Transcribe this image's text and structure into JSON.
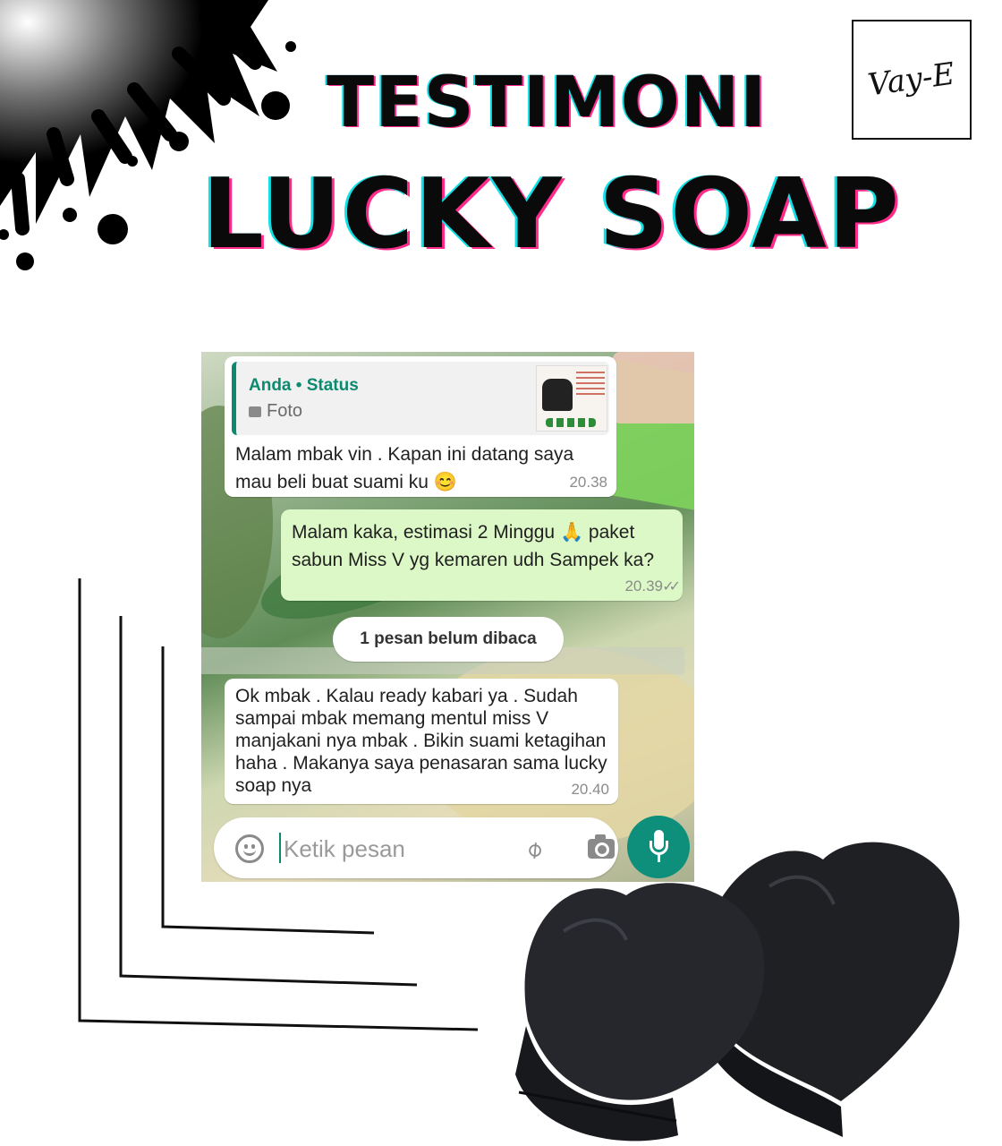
{
  "header": {
    "title_top": "TESTIMONI",
    "title_main": "LUCKY SOAP",
    "brand_logo": "Vay-E"
  },
  "chat": {
    "quoted": {
      "sender": "Anda • Status",
      "type": "Foto"
    },
    "messages": [
      {
        "direction": "incoming",
        "text": "Malam mbak vin . Kapan ini datang saya mau beli buat suami ku 😊",
        "time": "20.38"
      },
      {
        "direction": "outgoing",
        "text": "Malam kaka,  estimasi 2 Minggu 🙏 paket sabun Miss V yg kemaren udh Sampek ka?",
        "time": "20.39",
        "status": "read"
      },
      {
        "direction": "incoming",
        "text": "Ok mbak . Kalau ready kabari ya . Sudah sampai mbak memang mentul miss V manjakani nya mbak . Bikin suami ketagihan haha . Makanya saya penasaran sama lucky soap nya",
        "time": "20.40"
      }
    ],
    "unread_label": "1 pesan belum dibaca",
    "input_placeholder": "Ketik pesan",
    "accent_color": "#0c8a6f",
    "outgoing_bubble_color": "#dcf8c6",
    "icons": [
      "emoji-icon",
      "attach-icon",
      "camera-icon",
      "mic-icon"
    ]
  }
}
